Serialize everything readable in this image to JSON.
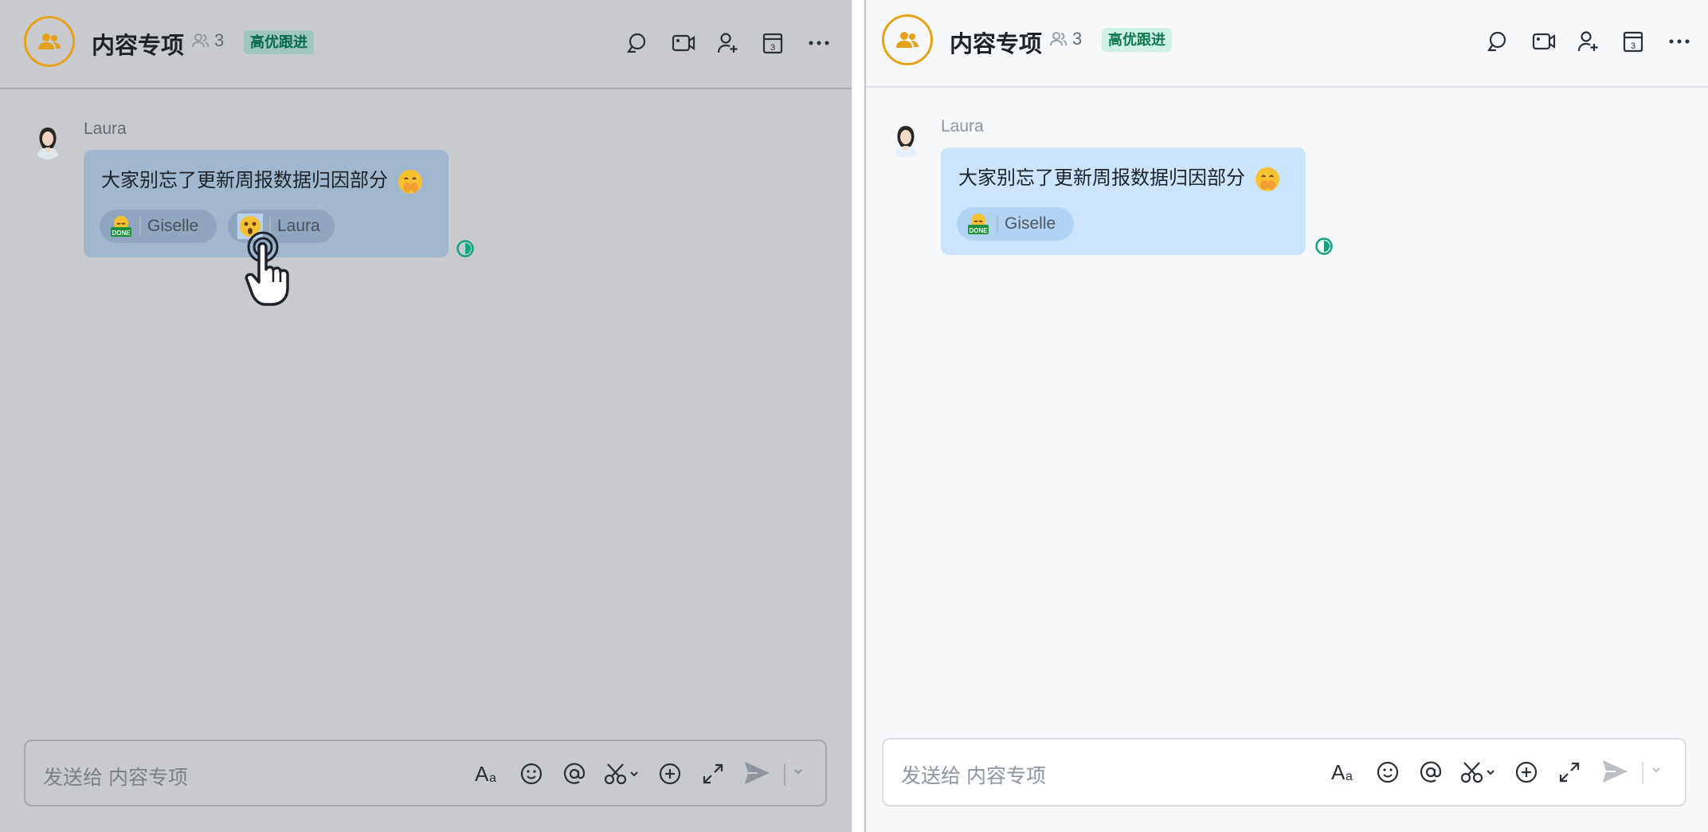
{
  "chat": {
    "title": "内容专项",
    "member_count": "3",
    "tag": "高优跟进",
    "actions": [
      "search-icon",
      "video-icon",
      "add-member-icon",
      "calendar-icon",
      "more-icon"
    ],
    "calendar_day": "3"
  },
  "message": {
    "sender": "Laura",
    "text": "大家别忘了更新周报数据归因部分",
    "trailing_emoji": "shushing-face-emoji"
  },
  "left_panel": {
    "reactions": [
      {
        "emoji": "done-emoji",
        "user": "Giselle"
      },
      {
        "emoji": "surprised-face-emoji",
        "user": "Laura"
      }
    ]
  },
  "right_panel": {
    "reactions": [
      {
        "emoji": "done-emoji",
        "user": "Giselle"
      }
    ]
  },
  "composer": {
    "placeholder": "发送给 内容专项",
    "tools": [
      "text-format-icon",
      "emoji-icon",
      "mention-icon",
      "scissors-icon",
      "add-icon",
      "expand-icon"
    ]
  },
  "colors": {
    "accent_orange": "#e6a21b",
    "tag_green": "#0f7a52",
    "bubble_blue": "#cce5ff",
    "read_status_green": "#14a37f"
  }
}
